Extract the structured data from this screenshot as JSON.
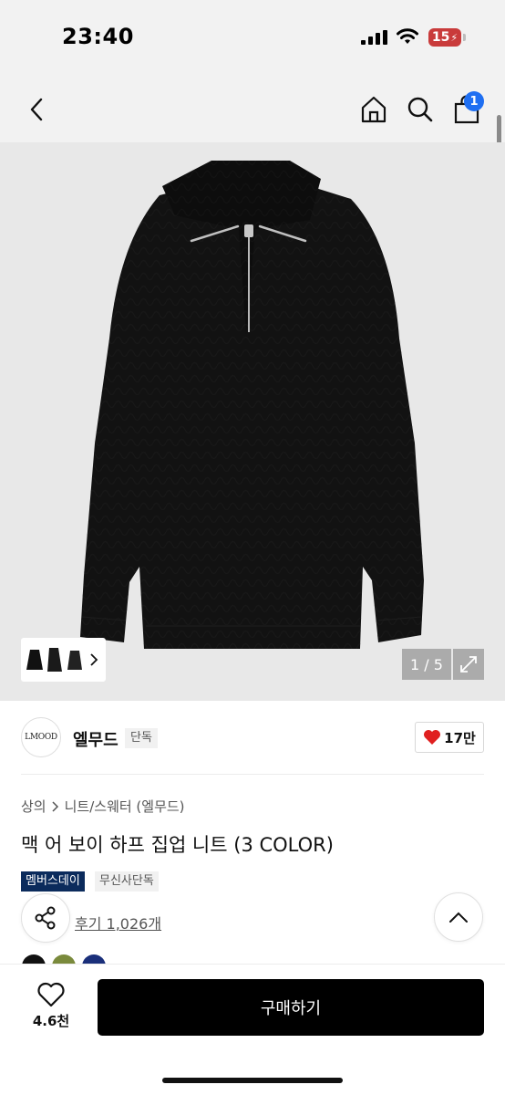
{
  "status_bar": {
    "time": "23:40",
    "battery_level": "15",
    "battery_color": "#c93b3b",
    "icons": [
      "signal-icon",
      "wifi-icon",
      "battery-icon"
    ]
  },
  "header": {
    "icons": [
      "back-icon",
      "home-icon",
      "search-icon",
      "cart-icon"
    ],
    "cart_badge": "1",
    "badge_color": "#1f6ff2"
  },
  "gallery": {
    "page_counter": "1 / 5",
    "current_page": 1,
    "total_pages": 5,
    "icons": [
      "chevron-right-icon",
      "expand-icon"
    ],
    "product_image": "black half-zip cable knit sweater"
  },
  "brand": {
    "logo_text": "LMOOD",
    "name": "엘무드",
    "tag": "단독",
    "likes": "17만"
  },
  "product": {
    "breadcrumb": [
      "상의",
      "니트/스웨터 (엘무드)"
    ],
    "title": "맥 어 보이 하프 집업 니트 (3 COLOR)",
    "tags": [
      "멤버스데이",
      "무신사단독"
    ],
    "review_link": "후기 1,026개",
    "color_swatches": [
      "#111111",
      "#7a8a3c",
      "#1a2f7a"
    ]
  },
  "bottom_bar": {
    "wish_count": "4.6천",
    "buy_label": "구매하기"
  }
}
